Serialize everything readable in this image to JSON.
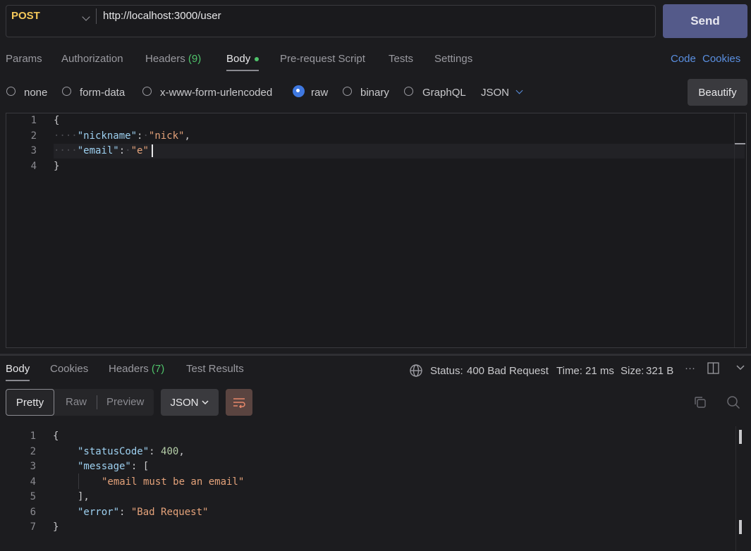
{
  "request": {
    "method": "POST",
    "url": "http://localhost:3000/user",
    "send_label": "Send"
  },
  "tabs": {
    "params": "Params",
    "authorization": "Authorization",
    "headers": "Headers",
    "headers_count": "(9)",
    "body": "Body",
    "prerequest": "Pre-request Script",
    "tests": "Tests",
    "settings": "Settings",
    "code": "Code",
    "cookies": "Cookies"
  },
  "body_types": {
    "none": "none",
    "form_data": "form-data",
    "urlencoded": "x-www-form-urlencoded",
    "raw": "raw",
    "binary": "binary",
    "graphql": "GraphQL",
    "format": "JSON",
    "beautify_label": "Beautify",
    "selected": "raw"
  },
  "editor": {
    "line_numbers": [
      "1",
      "2",
      "3",
      "4"
    ],
    "open_brace": "{",
    "close_brace": "}",
    "key1": "\"nickname\"",
    "val1": "\"nick\"",
    "key2": "\"email\"",
    "val2": "\"e\""
  },
  "response": {
    "tabs": {
      "body": "Body",
      "cookies": "Cookies",
      "headers": "Headers",
      "headers_count": "(7)",
      "test_results": "Test Results"
    },
    "status_label": "Status:",
    "status_value": "400 Bad Request",
    "time_label": "Time:",
    "time_value": "21 ms",
    "size_label": "Size:",
    "size_value": "321 B",
    "more": "···",
    "views": {
      "pretty": "Pretty",
      "raw": "Raw",
      "preview": "Preview",
      "format": "JSON"
    },
    "line_numbers": [
      "1",
      "2",
      "3",
      "4",
      "5",
      "6",
      "7"
    ],
    "open_brace": "{",
    "close_brace": "}",
    "key_status": "\"statusCode\"",
    "val_status": "400",
    "key_message": "\"message\"",
    "open_bracket": "[",
    "message_item": "\"email must be an email\"",
    "close_bracket": "],",
    "key_error": "\"error\"",
    "val_error": "\"Bad Request\""
  },
  "colors": {
    "status_ok": "#4fc36a",
    "accent": "#5a8fe0",
    "send": "#545a8a",
    "method": "#f4c85a"
  }
}
